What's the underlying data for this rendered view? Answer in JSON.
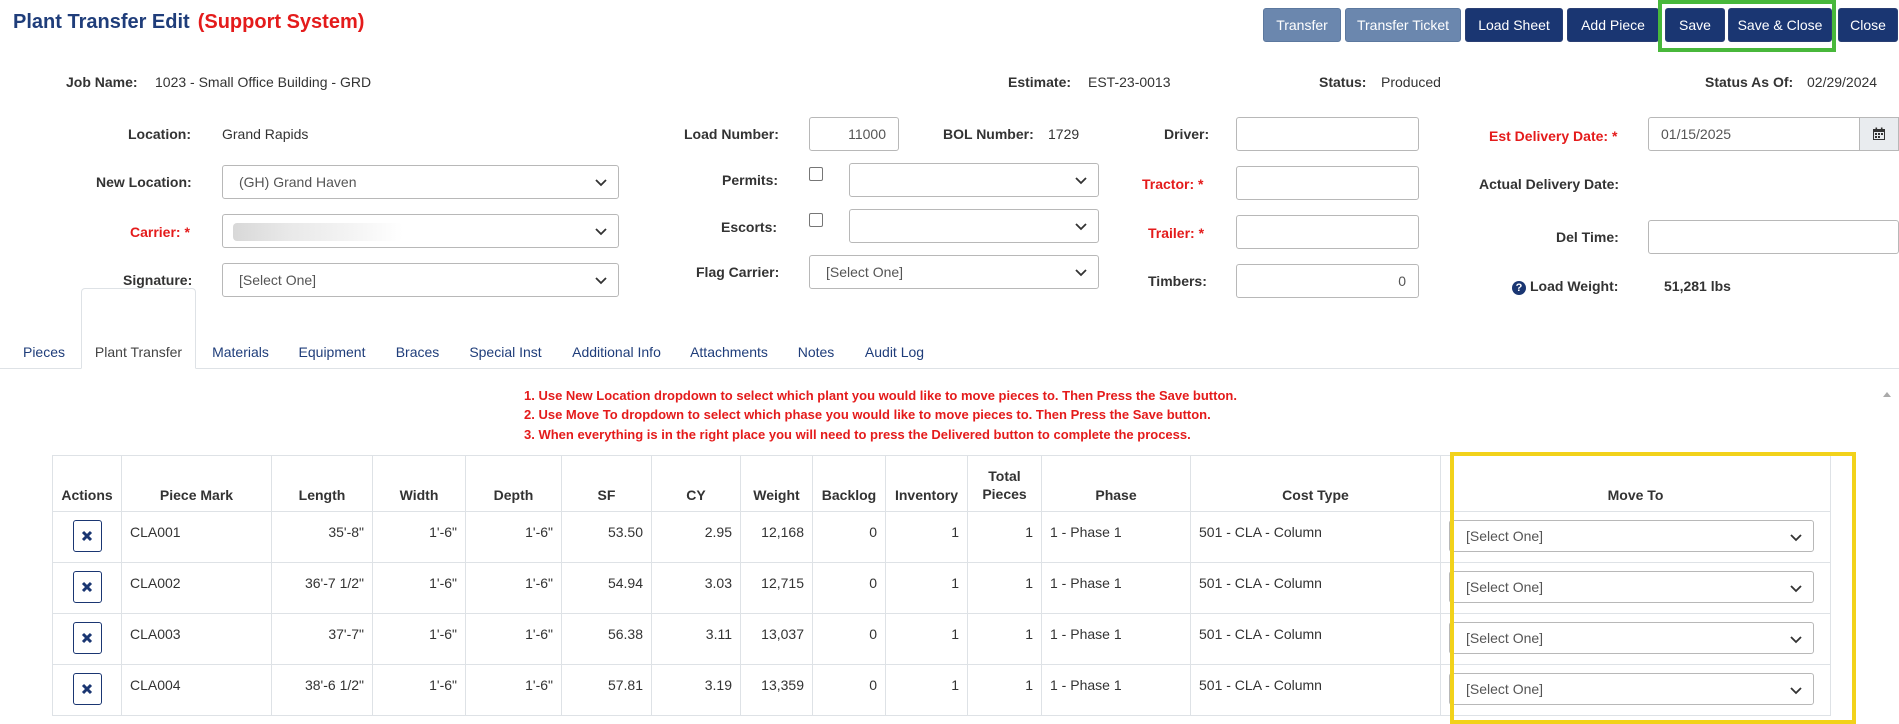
{
  "header": {
    "title": "Plant Transfer Edit",
    "subtitle": "(Support System)",
    "buttons": {
      "transfer": "Transfer",
      "transfer_ticket": "Transfer Ticket",
      "load_sheet": "Load Sheet",
      "add_piece": "Add Piece",
      "save": "Save",
      "save_close": "Save & Close",
      "close": "Close"
    }
  },
  "summary": {
    "job_name_label": "Job Name:",
    "job_name": "1023 - Small Office Building - GRD",
    "estimate_label": "Estimate:",
    "estimate": "EST-23-0013",
    "status_label": "Status:",
    "status": "Produced",
    "status_as_of_label": "Status As Of:",
    "status_as_of": "02/29/2024"
  },
  "form": {
    "location_label": "Location:",
    "location": "Grand Rapids",
    "new_location_label": "New Location:",
    "new_location": "(GH) Grand Haven",
    "carrier_label": "Carrier:",
    "required_mark": "*",
    "signature_label": "Signature:",
    "signature": "[Select One]",
    "load_number_label": "Load Number:",
    "load_number": "11000",
    "bol_label": "BOL Number:",
    "bol": "1729",
    "permits_label": "Permits:",
    "escorts_label": "Escorts:",
    "flag_carrier_label": "Flag Carrier:",
    "flag_carrier": "[Select One]",
    "driver_label": "Driver:",
    "tractor_label": "Tractor:",
    "trailer_label": "Trailer:",
    "timbers_label": "Timbers:",
    "timbers": "0",
    "est_delivery_label": "Est Delivery Date:",
    "est_delivery": "01/15/2025",
    "actual_delivery_label": "Actual Delivery Date:",
    "del_time_label": "Del Time:",
    "load_weight_label": "Load Weight:",
    "load_weight": "51,281 lbs"
  },
  "tabs": [
    "Pieces",
    "Plant Transfer",
    "Materials",
    "Equipment",
    "Braces",
    "Special Inst",
    "Additional Info",
    "Attachments",
    "Notes",
    "Audit Log"
  ],
  "active_tab": "Plant Transfer",
  "instructions": [
    "1. Use New Location dropdown to select which plant you would like to move pieces to. Then Press the Save button.",
    "2. Use Move To dropdown to select which phase you would like to move pieces to. Then Press the Save button.",
    "3. When everything is in the right place you will need to press the Delivered button to complete the process."
  ],
  "table": {
    "columns": [
      "Actions",
      "Piece Mark",
      "Length",
      "Width",
      "Depth",
      "SF",
      "CY",
      "Weight",
      "Backlog",
      "Inventory",
      "Total Pieces",
      "Phase",
      "Cost Type",
      "Move To"
    ],
    "rows": [
      {
        "piece_mark": "CLA001",
        "length": "35'-8\"",
        "width": "1'-6\"",
        "depth": "1'-6\"",
        "sf": "53.50",
        "cy": "2.95",
        "weight": "12,168",
        "backlog": "0",
        "inventory": "1",
        "total": "1",
        "phase": "1 - Phase 1",
        "cost_type": "501 - CLA - Column",
        "move_to": "[Select One]"
      },
      {
        "piece_mark": "CLA002",
        "length": "36'-7 1/2\"",
        "width": "1'-6\"",
        "depth": "1'-6\"",
        "sf": "54.94",
        "cy": "3.03",
        "weight": "12,715",
        "backlog": "0",
        "inventory": "1",
        "total": "1",
        "phase": "1 - Phase 1",
        "cost_type": "501 - CLA - Column",
        "move_to": "[Select One]"
      },
      {
        "piece_mark": "CLA003",
        "length": "37'-7\"",
        "width": "1'-6\"",
        "depth": "1'-6\"",
        "sf": "56.38",
        "cy": "3.11",
        "weight": "13,037",
        "backlog": "0",
        "inventory": "1",
        "total": "1",
        "phase": "1 - Phase 1",
        "cost_type": "501 - CLA - Column",
        "move_to": "[Select One]"
      },
      {
        "piece_mark": "CLA004",
        "length": "38'-6 1/2\"",
        "width": "1'-6\"",
        "depth": "1'-6\"",
        "sf": "57.81",
        "cy": "3.19",
        "weight": "13,359",
        "backlog": "0",
        "inventory": "1",
        "total": "1",
        "phase": "1 - Phase 1",
        "cost_type": "501 - CLA - Column",
        "move_to": "[Select One]"
      }
    ]
  },
  "colors": {
    "navy": "#1a3672",
    "required_red": "#e41b1b",
    "highlight_green": "#48b83b",
    "highlight_yellow": "#f2d21a"
  },
  "icons": [
    "chevron-down-icon",
    "calendar-icon",
    "question-circle-icon",
    "remove-x-icon"
  ]
}
